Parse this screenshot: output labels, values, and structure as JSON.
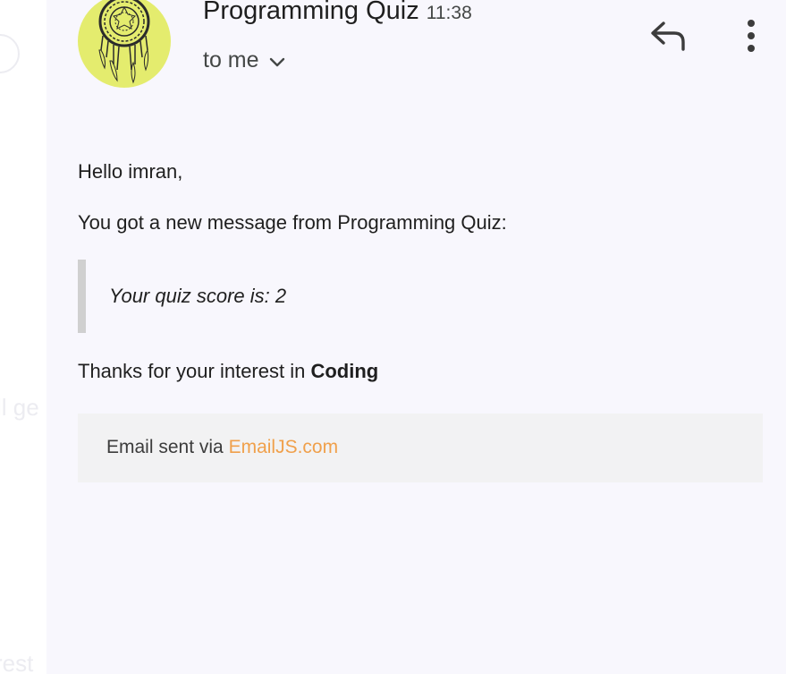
{
  "background_fragments": {
    "mid": "ll ge",
    "bottom": "rest"
  },
  "email": {
    "sender_name": "Programming Quiz",
    "time": "11:38",
    "recipient": "to me",
    "greeting": "Hello imran,",
    "intro": "You got a new message from Programming Quiz:",
    "quote": "Your quiz score is: 2",
    "thanks_prefix": "Thanks for your interest in ",
    "thanks_bold": "Coding",
    "footer_prefix": "Email sent via ",
    "footer_link": "EmailJS.com"
  },
  "icons": {
    "reply": "reply-icon",
    "more": "more-vert-icon",
    "expand": "chevron-down-icon"
  },
  "colors": {
    "avatar_bg": "#e4ec6e",
    "link": "#f0a04b",
    "quote_border": "#d0d0d0",
    "card_bg": "#f8f7fd"
  }
}
